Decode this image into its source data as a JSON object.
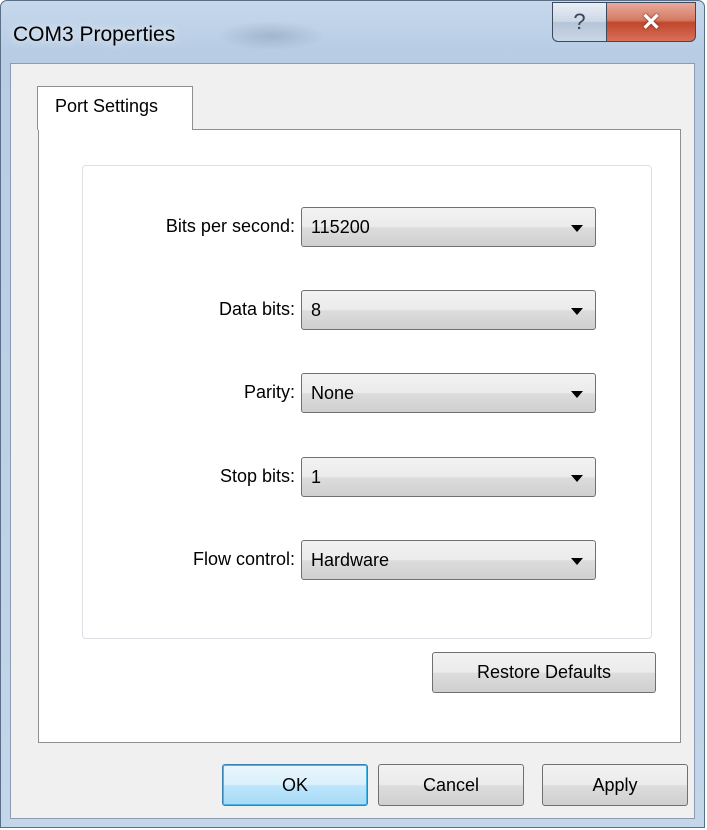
{
  "window": {
    "title": "COM3 Properties",
    "help_glyph": "?",
    "close_glyph": "✕"
  },
  "tabs": [
    {
      "label": "Port Settings"
    }
  ],
  "settings": [
    {
      "label": "Bits per second:",
      "value": "115200"
    },
    {
      "label": "Data bits:",
      "value": "8"
    },
    {
      "label": "Parity:",
      "value": "None"
    },
    {
      "label": "Stop bits:",
      "value": "1"
    },
    {
      "label": "Flow control:",
      "value": "Hardware"
    }
  ],
  "buttons": {
    "restore_defaults": "Restore Defaults",
    "ok": "OK",
    "cancel": "Cancel",
    "apply": "Apply"
  }
}
